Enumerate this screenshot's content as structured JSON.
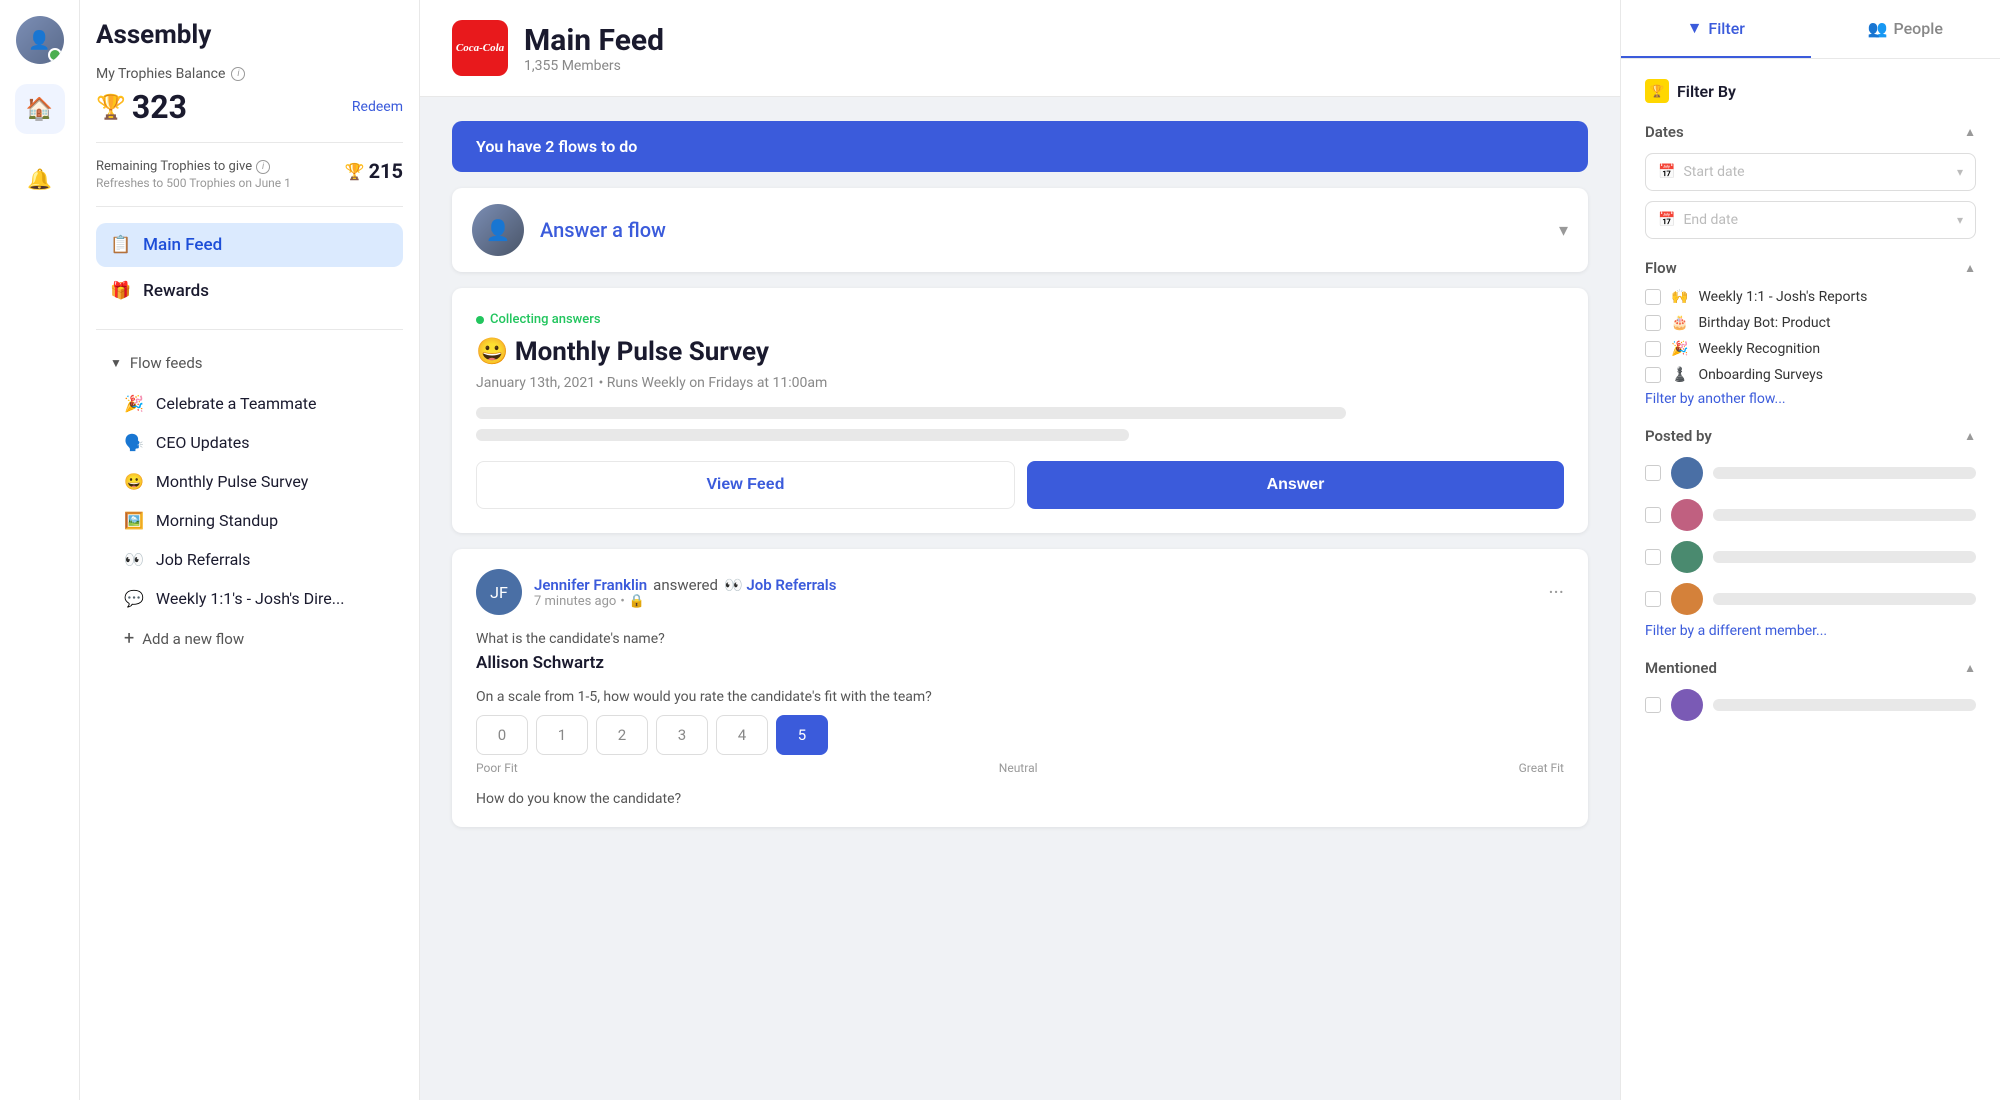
{
  "iconBar": {
    "homeIconLabel": "🏠",
    "bellIconLabel": "🔔"
  },
  "sidebar": {
    "title": "Assembly",
    "trophiesLabel": "My Trophies Balance",
    "trophiesAmount": "323",
    "redeemLabel": "Redeem",
    "remainingLabel": "Remaining Trophies to give",
    "remainingSub": "Refreshes to 500 Trophies on June 1",
    "remainingAmount": "215",
    "navItems": [
      {
        "id": "main-feed",
        "icon": "📋",
        "label": "Main Feed",
        "active": true
      },
      {
        "id": "rewards",
        "icon": "🎁",
        "label": "Rewards",
        "active": false
      }
    ],
    "flowFeedsLabel": "Flow feeds",
    "flowItems": [
      {
        "icon": "🎉",
        "label": "Celebrate a Teammate"
      },
      {
        "icon": "🗣️",
        "label": "CEO Updates"
      },
      {
        "icon": "😀",
        "label": "Monthly Pulse Survey"
      },
      {
        "icon": "🖼️",
        "label": "Morning Standup"
      },
      {
        "icon": "👀",
        "label": "Job Referrals"
      },
      {
        "icon": "💬",
        "label": "Weekly 1:1's - Josh's Dire..."
      }
    ],
    "addFlowLabel": "Add a new flow"
  },
  "feedHeader": {
    "logoText": "Coca‑Cola",
    "title": "Main Feed",
    "subtitle": "1,355 Members"
  },
  "flowTodoBanner": {
    "text": "You have 2 flows to do"
  },
  "answerFlow": {
    "text": "Answer a flow"
  },
  "surveyCard": {
    "collectingLabel": "Collecting answers",
    "title": "😀 Monthly Pulse Survey",
    "dateInfo": "January 13th, 2021 • Runs Weekly on Fridays at 11:00am",
    "viewFeedLabel": "View Feed",
    "answerLabel": "Answer"
  },
  "postCard": {
    "author": "Jennifer Franklin",
    "action": "answered",
    "flow": "👀 Job Referrals",
    "timeAgo": "7 minutes ago",
    "privateIcon": "🔒",
    "question1": "What is the candidate's name?",
    "answer1": "Allison Schwartz",
    "question2": "On a scale from 1-5, how would you rate the candidate's fit with the team?",
    "ratingOptions": [
      "0",
      "1",
      "2",
      "3",
      "4",
      "5"
    ],
    "activeRating": 5,
    "ratingLabelLeft": "Poor Fit",
    "ratingLabelMid": "Neutral",
    "ratingLabelRight": "Great Fit",
    "question3": "How do you know the candidate?"
  },
  "rightPanel": {
    "filterTabLabel": "Filter",
    "peopleTabLabel": "People",
    "filterByLabel": "Filter By",
    "sections": {
      "dates": {
        "label": "Dates",
        "startDatePlaceholder": "Start date",
        "endDatePlaceholder": "End date"
      },
      "flow": {
        "label": "Flow",
        "items": [
          {
            "icon": "🙌",
            "label": "Weekly 1:1 - Josh's Reports"
          },
          {
            "icon": "🎂",
            "label": "Birthday Bot: Product"
          },
          {
            "icon": "🎉",
            "label": "Weekly Recognition"
          },
          {
            "icon": "♟️",
            "label": "Onboarding Surveys"
          }
        ],
        "filterLinkLabel": "Filter by another flow..."
      },
      "postedBy": {
        "label": "Posted by",
        "filterLinkLabel": "Filter by a different member..."
      },
      "mentioned": {
        "label": "Mentioned"
      }
    }
  }
}
